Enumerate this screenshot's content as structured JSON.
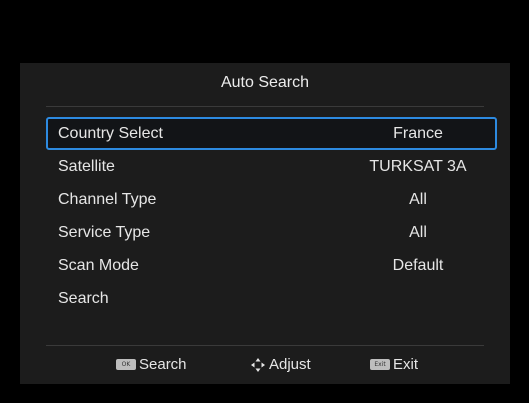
{
  "dialog": {
    "title": "Auto Search"
  },
  "menu": {
    "items": [
      {
        "label": "Country Select",
        "value": "France",
        "selected": true
      },
      {
        "label": "Satellite",
        "value": "TURKSAT 3A",
        "selected": false
      },
      {
        "label": "Channel Type",
        "value": "All",
        "selected": false
      },
      {
        "label": "Service Type",
        "value": "All",
        "selected": false
      },
      {
        "label": "Scan Mode",
        "value": "Default",
        "selected": false
      },
      {
        "label": "Search",
        "value": "",
        "selected": false
      }
    ]
  },
  "footer": {
    "search_key": "OK",
    "search_label": "Search",
    "adjust_icon": "dpad-left-right-up-down-icon",
    "adjust_label": "Adjust",
    "exit_key": "Exit",
    "exit_label": "Exit"
  },
  "colors": {
    "background": "#000000",
    "dialog": "#1c1c1c",
    "highlight_border": "#2d8ae0",
    "text": "#e6e6e6"
  }
}
